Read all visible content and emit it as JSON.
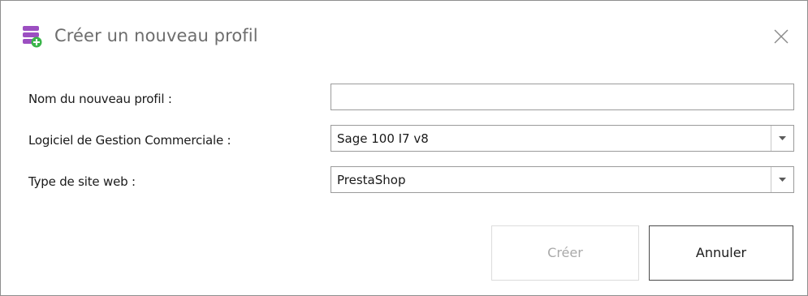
{
  "dialog": {
    "title": "Créer un nouveau profil",
    "icon": "database-add-icon",
    "accent_color": "#9c4fc1",
    "add_color": "#3ab54a"
  },
  "form": {
    "profile_name": {
      "label": "Nom du nouveau profil :",
      "value": "",
      "placeholder": ""
    },
    "software": {
      "label": "Logiciel de Gestion Commerciale :",
      "selected": "Sage 100 I7 v8"
    },
    "site_type": {
      "label": "Type de site web :",
      "selected": "PrestaShop"
    }
  },
  "buttons": {
    "create": "Créer",
    "cancel": "Annuler"
  }
}
